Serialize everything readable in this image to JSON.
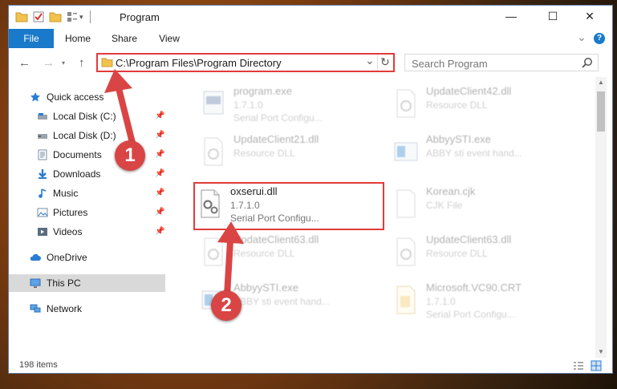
{
  "window": {
    "title": "Program",
    "controls": {
      "minimize": "—",
      "maximize": "☐",
      "close": "✕"
    }
  },
  "ribbon": {
    "tabs": [
      "File",
      "Home",
      "Share",
      "View"
    ],
    "expand_glyph": "⌄",
    "help_glyph": "?"
  },
  "address_bar": {
    "path": "C:\\Program Files\\Program Directory",
    "dropdown_glyph": "⌄",
    "refresh_glyph": "↻"
  },
  "search": {
    "placeholder": "Search Program"
  },
  "sidebar": {
    "items": [
      {
        "label": "Quick access",
        "icon": "star-icon",
        "pinned": false
      },
      {
        "label": "Local Disk (C:)",
        "icon": "drive-icon",
        "pinned": true
      },
      {
        "label": "Local Disk (D:)",
        "icon": "drive-icon",
        "pinned": true
      },
      {
        "label": "Documents",
        "icon": "documents-icon",
        "pinned": true
      },
      {
        "label": "Downloads",
        "icon": "downloads-icon",
        "pinned": true
      },
      {
        "label": "Music",
        "icon": "music-icon",
        "pinned": true
      },
      {
        "label": "Pictures",
        "icon": "pictures-icon",
        "pinned": true
      },
      {
        "label": "Videos",
        "icon": "videos-icon",
        "pinned": true
      },
      {
        "label": "OneDrive",
        "icon": "cloud-icon",
        "pinned": false
      },
      {
        "label": "This PC",
        "icon": "computer-icon",
        "pinned": false
      },
      {
        "label": "Network",
        "icon": "network-icon",
        "pinned": false
      }
    ]
  },
  "files": [
    {
      "name": "program.exe",
      "version": "1.7.1.0",
      "desc": "Serial Port Configu..."
    },
    {
      "name": "UpdateClient42.dll",
      "version": "",
      "desc": "Resource DLL"
    },
    {
      "name": "UpdateClient21.dll",
      "version": "",
      "desc": "Resource DLL"
    },
    {
      "name": "AbbyySTI.exe",
      "version": "",
      "desc": "ABBY sti event hand..."
    },
    {
      "name": "oxserui.dll",
      "version": "1.7.1.0",
      "desc": "Serial Port Configu..."
    },
    {
      "name": "Korean.cjk",
      "version": "",
      "desc": "CJK File"
    },
    {
      "name": "UpdateClient63.dll",
      "version": "",
      "desc": "Resource DLL"
    },
    {
      "name": "UpdateClient63.dll",
      "version": "",
      "desc": "Resource DLL"
    },
    {
      "name": "AbbyySTI.exe",
      "version": "",
      "desc": "ABBY sti event hand..."
    },
    {
      "name": "Microsoft.VC90.CRT",
      "version": "1.7.1.0",
      "desc": "Serial Port Configu..."
    }
  ],
  "status": {
    "items_count": "198 items"
  },
  "annotations": {
    "step1": "1",
    "step2": "2"
  },
  "colors": {
    "accent": "#1979ca",
    "highlight": "#e23b3b",
    "badge": "#d94545"
  }
}
